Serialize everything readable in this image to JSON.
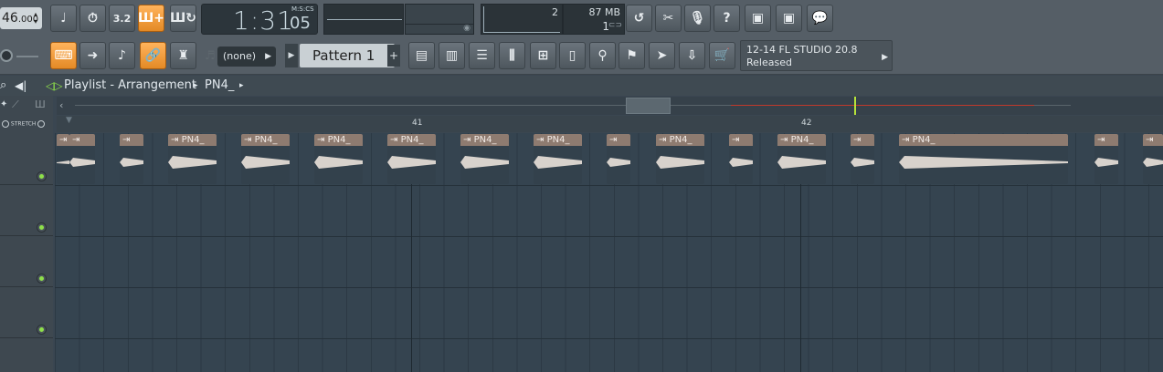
{
  "tempo": {
    "value": "46",
    "decimals": ".000"
  },
  "time": {
    "minsec": "1:31",
    "centisec": "05",
    "label": "M:S:CS"
  },
  "cpu": {
    "value": "2",
    "poly": "1"
  },
  "memory": {
    "value": "87 MB"
  },
  "pattern": {
    "dropdown": "(none)",
    "name": "Pattern 1"
  },
  "hint": {
    "line1": "12-14  FL STUDIO 20.8",
    "line2": "Released"
  },
  "playlist": {
    "title": "Playlist - Arrangement",
    "separator": "▸",
    "clip": "PN4_",
    "stretch": "STRETCH"
  },
  "ruler": {
    "bar1": "41",
    "bar2": "42"
  },
  "clips": [
    {
      "label": ""
    },
    {
      "label": ""
    },
    {
      "label": ""
    },
    {
      "label": "PN4_"
    },
    {
      "label": "PN4_"
    },
    {
      "label": "PN4_"
    },
    {
      "label": "PN4_"
    },
    {
      "label": "PN4_"
    },
    {
      "label": "PN4_"
    },
    {
      "label": ""
    },
    {
      "label": "PN4_"
    },
    {
      "label": ""
    },
    {
      "label": "PN4_"
    },
    {
      "label": ""
    },
    {
      "label": "PN4_"
    },
    {
      "label": ""
    },
    {
      "label": ""
    }
  ],
  "colors": {
    "accent": "#f3a043",
    "clip_header": "#8e7b70",
    "grid": "#354450",
    "waveform": "#d8d2cc"
  }
}
